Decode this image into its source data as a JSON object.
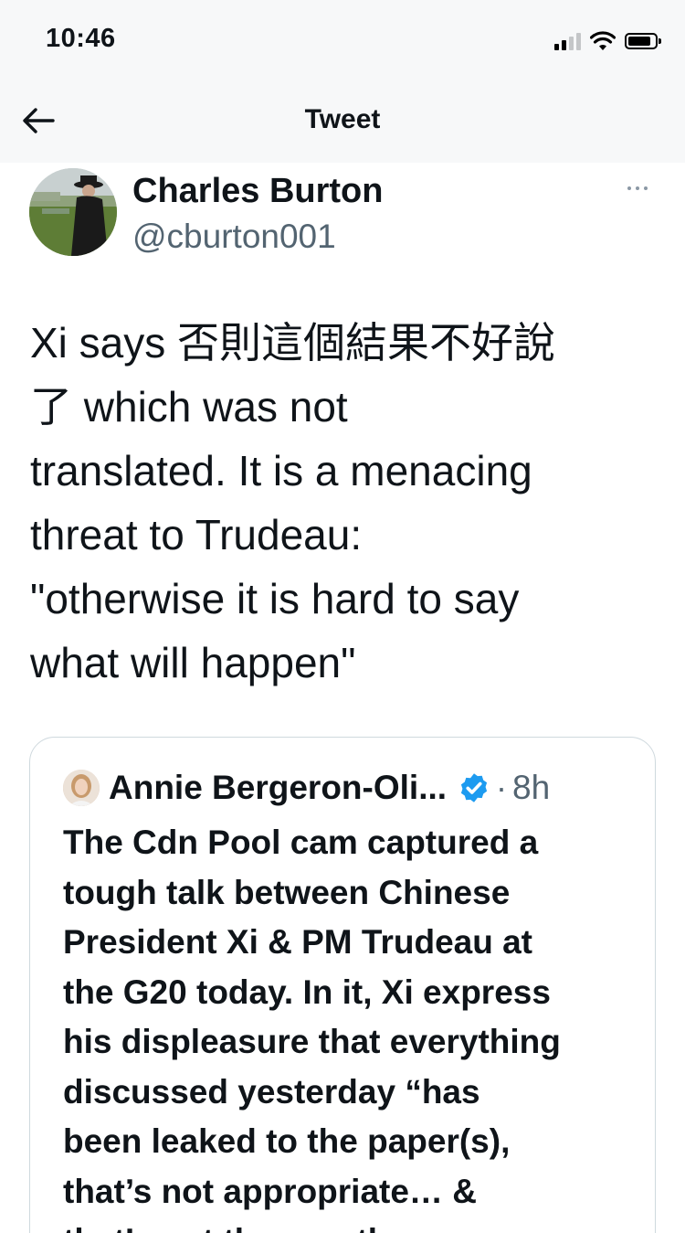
{
  "status_bar": {
    "time": "10:46",
    "signal_icon": "cellular-signal-icon",
    "wifi_icon": "wifi-icon",
    "battery_icon": "battery-icon"
  },
  "header": {
    "back_icon": "back-arrow-icon",
    "title": "Tweet"
  },
  "tweet": {
    "author": {
      "display_name": "Charles Burton",
      "handle": "@cburton001",
      "avatar_icon": "avatar"
    },
    "more_icon": "more-options-icon",
    "text": "Xi says 否則這個結果不好說\n了 which was not\ntranslated. It is a menacing\nthreat to Trudeau:\n\"otherwise it is hard to say\nwhat will happen\"",
    "quoted": {
      "author_name": "Annie Bergeron-Oli...",
      "verified_icon": "verified-badge-icon",
      "separator": "·",
      "time": "8h",
      "text": "The Cdn Pool cam captured a\ntough talk between Chinese\nPresident Xi & PM Trudeau at\nthe G20 today. In it, Xi express\nhis displeasure that everything\ndiscussed yesterday “has\nbeen leaked to the paper(s),\nthat’s not appropriate… &\nthat’s not the way the"
    }
  },
  "colors": {
    "text_primary": "#0f1419",
    "text_secondary": "#536471",
    "verified_blue": "#1d9bf0",
    "border": "#cfd9de"
  }
}
